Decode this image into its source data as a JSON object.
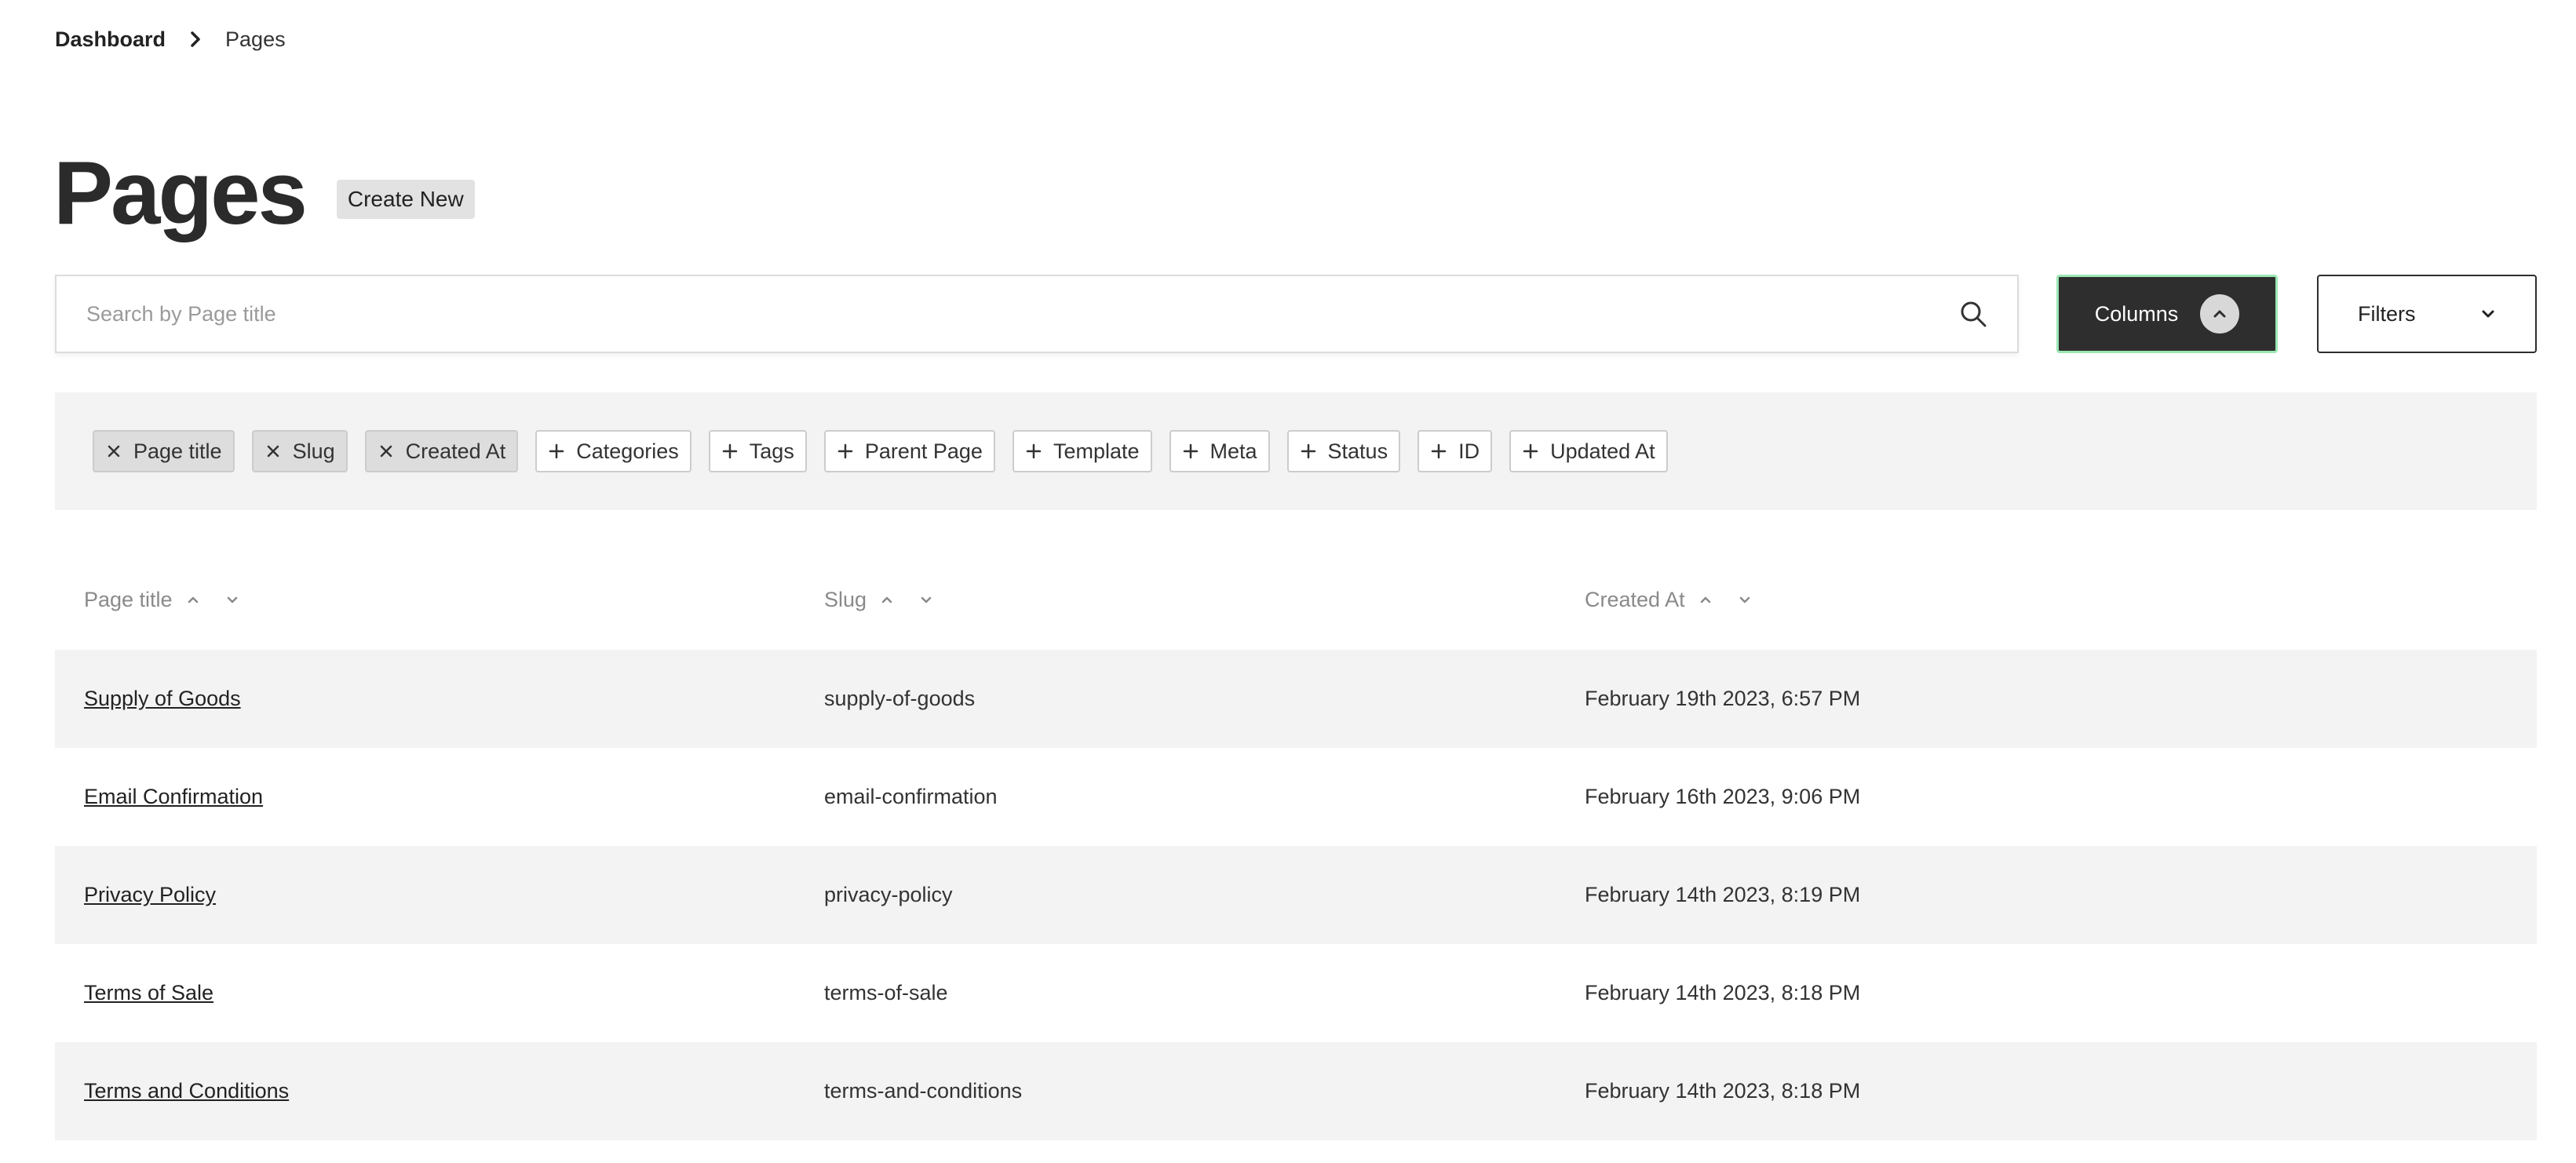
{
  "breadcrumb": {
    "home": "Dashboard",
    "current": "Pages"
  },
  "header": {
    "title": "Pages",
    "create_label": "Create New"
  },
  "search": {
    "placeholder": "Search by Page title",
    "value": ""
  },
  "toolbar": {
    "columns_label": "Columns",
    "filters_label": "Filters",
    "columns_active_color": "#2e2e2e",
    "columns_focus_color": "#9be7b4"
  },
  "chips": {
    "active": [
      "Page title",
      "Slug",
      "Created At"
    ],
    "available": [
      "Categories",
      "Tags",
      "Parent Page",
      "Template",
      "Meta",
      "Status",
      "ID",
      "Updated At"
    ]
  },
  "table": {
    "columns": [
      "Page title",
      "Slug",
      "Created At"
    ],
    "rows": [
      {
        "title": "Supply of Goods",
        "slug": "supply-of-goods",
        "created": "February 19th 2023, 6:57 PM"
      },
      {
        "title": "Email Confirmation",
        "slug": "email-confirmation",
        "created": "February 16th 2023, 9:06 PM"
      },
      {
        "title": "Privacy Policy",
        "slug": "privacy-policy",
        "created": "February 14th 2023, 8:19 PM"
      },
      {
        "title": "Terms of Sale",
        "slug": "terms-of-sale",
        "created": "February 14th 2023, 8:18 PM"
      },
      {
        "title": "Terms and Conditions",
        "slug": "terms-and-conditions",
        "created": "February 14th 2023, 8:18 PM"
      }
    ]
  }
}
